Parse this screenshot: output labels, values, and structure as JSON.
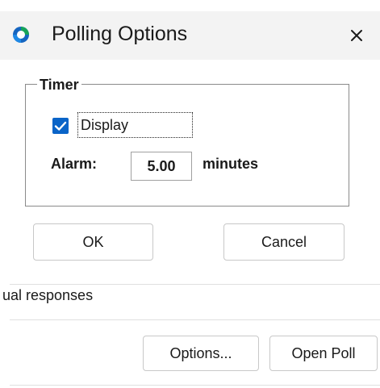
{
  "dialog": {
    "title": "Polling Options",
    "timer_group": {
      "legend": "Timer",
      "display_checkbox": {
        "label": "Display",
        "checked": true
      },
      "alarm": {
        "label": "Alarm:",
        "value": "5.00",
        "unit": "minutes"
      }
    },
    "buttons": {
      "ok": "OK",
      "cancel": "Cancel"
    }
  },
  "background_window": {
    "partial_text": "ual responses",
    "buttons": {
      "options": "Options...",
      "open_poll": "Open Poll"
    }
  },
  "colors": {
    "accent": "#0a64c8",
    "titlebar": "#f3f3f3",
    "icon_green": "#16a35a",
    "icon_blue": "#1565c0"
  }
}
